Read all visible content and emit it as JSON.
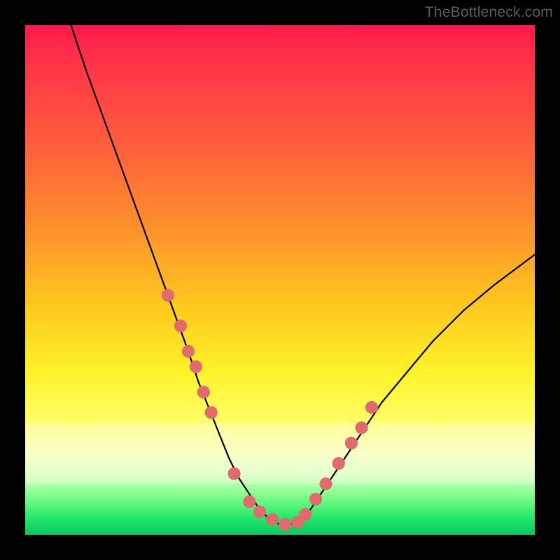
{
  "watermark": "TheBottleneck.com",
  "chart_data": {
    "type": "line",
    "title": "",
    "xlabel": "",
    "ylabel": "",
    "xlim": [
      0,
      100
    ],
    "ylim": [
      0,
      100
    ],
    "legend": false,
    "grid": false,
    "series": [
      {
        "name": "bottleneck-curve",
        "x": [
          9,
          12,
          16,
          20,
          24,
          28,
          32,
          34,
          36,
          38,
          40,
          42,
          44,
          46,
          48,
          50,
          52,
          54,
          56,
          58,
          62,
          66,
          70,
          75,
          80,
          86,
          92,
          100
        ],
        "values": [
          100,
          91,
          80,
          69,
          58,
          47,
          36,
          30,
          25,
          20,
          15,
          11,
          8,
          5,
          3,
          2,
          2,
          3,
          5,
          8,
          14,
          20,
          26,
          32,
          38,
          44,
          49,
          55
        ]
      }
    ],
    "markers": {
      "name": "highlight-points",
      "color": "#e06a6e",
      "radius_plot_units": 1.25,
      "x": [
        28.0,
        30.5,
        32.0,
        33.5,
        35.0,
        36.5,
        41.0,
        44.0,
        46.0,
        48.5,
        51.0,
        53.5,
        55.0,
        57.0,
        59.0,
        61.5,
        64.0,
        66.0,
        68.0
      ],
      "values": [
        47.0,
        41.0,
        36.0,
        33.0,
        28.0,
        24.0,
        12.0,
        6.5,
        4.5,
        3.0,
        2.0,
        2.5,
        4.0,
        7.0,
        10.0,
        14.0,
        18.0,
        21.0,
        25.0
      ]
    },
    "pale_band_y": [
      10,
      22
    ],
    "background_gradient": {
      "direction": "vertical",
      "stops": [
        {
          "pos": 0.0,
          "color": "#ff1a4b"
        },
        {
          "pos": 0.55,
          "color": "#ffc81e"
        },
        {
          "pos": 0.78,
          "color": "#ffff66"
        },
        {
          "pos": 1.0,
          "color": "#08c95e"
        }
      ]
    }
  }
}
